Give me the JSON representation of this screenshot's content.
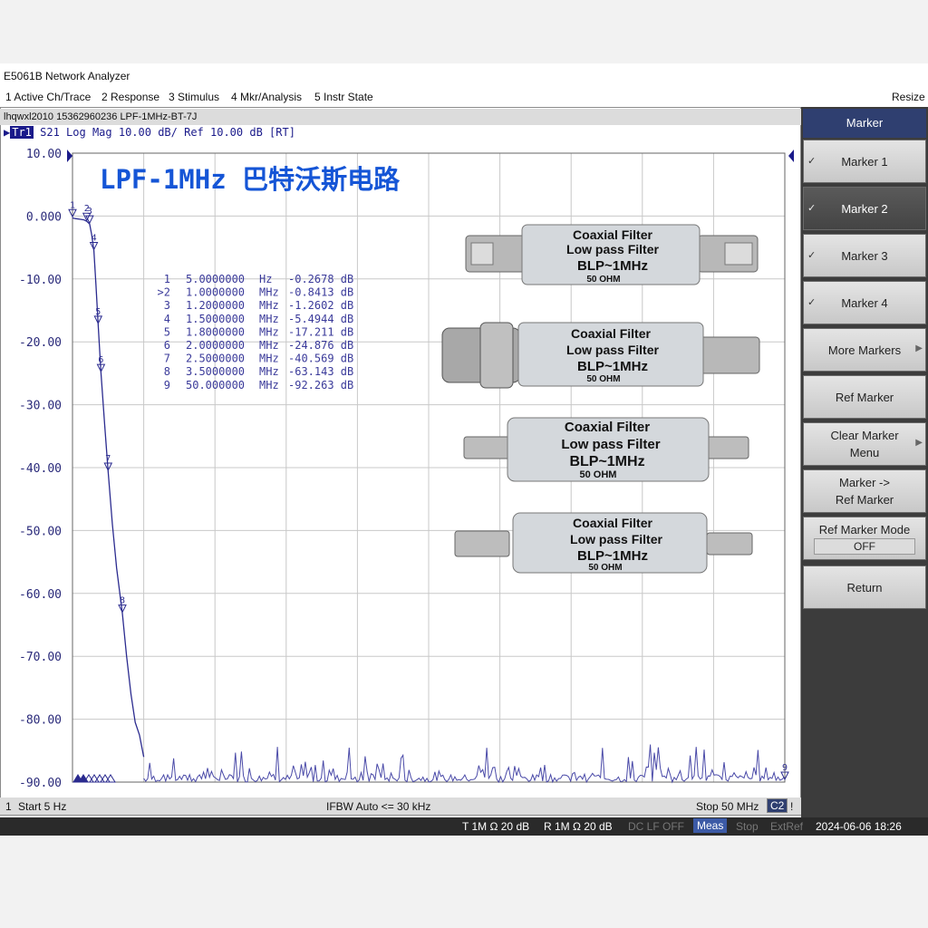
{
  "window": {
    "title": "E5061B Network Analyzer"
  },
  "menu": {
    "items": [
      "1 Active Ch/Trace",
      "2 Response",
      "3 Stimulus",
      "4 Mkr/Analysis",
      "5 Instr State"
    ],
    "resize": "Resize"
  },
  "info": {
    "line": "lhqwxl2010  15362960236   LPF-1MHz-BT-7J"
  },
  "trace": {
    "tag": "Tr1",
    "desc": "S21 Log Mag 10.00 dB/ Ref 10.00 dB [RT]"
  },
  "overlay": {
    "title": "LPF-1MHz 巴特沃斯电路"
  },
  "filter_label": {
    "line1": "Coaxial Filter",
    "line2": "Low pass Filter",
    "line3": "BLP~1MHz",
    "line4": "50  OHM"
  },
  "marker_table": [
    {
      "num": "1",
      "freq": "5.0000000",
      "unit": "Hz",
      "val": "-0.2678 dB"
    },
    {
      "num": ">2",
      "freq": "1.0000000",
      "unit": "MHz",
      "val": "-0.8413 dB"
    },
    {
      "num": "3",
      "freq": "1.2000000",
      "unit": "MHz",
      "val": "-1.2602 dB"
    },
    {
      "num": "4",
      "freq": "1.5000000",
      "unit": "MHz",
      "val": "-5.4944 dB"
    },
    {
      "num": "5",
      "freq": "1.8000000",
      "unit": "MHz",
      "val": "-17.211 dB"
    },
    {
      "num": "6",
      "freq": "2.0000000",
      "unit": "MHz",
      "val": "-24.876 dB"
    },
    {
      "num": "7",
      "freq": "2.5000000",
      "unit": "MHz",
      "val": "-40.569 dB"
    },
    {
      "num": "8",
      "freq": "3.5000000",
      "unit": "MHz",
      "val": "-63.143 dB"
    },
    {
      "num": "9",
      "freq": "50.000000",
      "unit": "MHz",
      "val": "-92.263 dB"
    }
  ],
  "footer": {
    "ch": "1",
    "start": "Start 5 Hz",
    "ifbw": "IFBW Auto <= 30 kHz",
    "stop": "Stop 50 MHz",
    "c2": "C2",
    "bang": "!"
  },
  "status": {
    "t": "T 1M Ω 20 dB",
    "r": "R 1M Ω 20 dB",
    "dclf": "DC LF OFF",
    "meas": "Meas",
    "stop": "Stop",
    "extref": "ExtRef",
    "datetime": "2024-06-06 18:26"
  },
  "softkeys": {
    "header": "Marker",
    "marker1": "Marker 1",
    "marker2": "Marker 2",
    "marker3": "Marker 3",
    "marker4": "Marker 4",
    "more": "More Markers",
    "ref": "Ref Marker",
    "clear1": "Clear Marker",
    "clear2": "Menu",
    "toref1": "Marker ->",
    "toref2": "Ref Marker",
    "mode": "Ref Marker Mode",
    "mode_val": "OFF",
    "ret": "Return"
  },
  "chart_data": {
    "type": "line",
    "y_ticks": [
      "10.00",
      "0.000",
      "-10.00",
      "-20.00",
      "-30.00",
      "-40.00",
      "-50.00",
      "-60.00",
      "-70.00",
      "-80.00",
      "-90.00"
    ],
    "ylim": [
      -90,
      10
    ],
    "xlim_mhz": [
      0,
      50
    ],
    "series": [
      {
        "x_mhz": [
          0,
          0.2,
          0.5,
          0.8,
          1.0,
          1.2,
          1.35,
          1.5,
          1.65,
          1.8,
          2.0,
          2.25,
          2.5,
          2.8,
          3.1,
          3.5,
          3.8,
          4.1,
          4.4,
          4.7,
          5.0
        ],
        "y_db": [
          -0.3,
          -0.4,
          -0.5,
          -0.6,
          -0.84,
          -1.26,
          -3.0,
          -5.49,
          -11.0,
          -17.21,
          -24.88,
          -33.0,
          -40.57,
          -49.0,
          -56.0,
          -63.14,
          -70.0,
          -76.0,
          -80.5,
          -82.5,
          -86.0
        ]
      }
    ],
    "markers": [
      {
        "label": "1",
        "x_mhz": 0.0,
        "y_db": -0.27
      },
      {
        "label": "2",
        "x_mhz": 1.0,
        "y_db": -0.84
      },
      {
        "label": "3",
        "x_mhz": 1.2,
        "y_db": -1.26
      },
      {
        "label": "4",
        "x_mhz": 1.5,
        "y_db": -5.49
      },
      {
        "label": "5",
        "x_mhz": 1.8,
        "y_db": -17.21
      },
      {
        "label": "6",
        "x_mhz": 2.0,
        "y_db": -24.88
      },
      {
        "label": "7",
        "x_mhz": 2.5,
        "y_db": -40.57
      },
      {
        "label": "8",
        "x_mhz": 3.5,
        "y_db": -63.14
      },
      {
        "label": "9",
        "x_mhz": 50.0,
        "y_db": -92.26
      }
    ]
  },
  "colors": {
    "trace": "#2b2b8f",
    "grid": "#c8c8c8",
    "overlay_title": "#1555d6",
    "panel_header": "#2f3f70"
  }
}
